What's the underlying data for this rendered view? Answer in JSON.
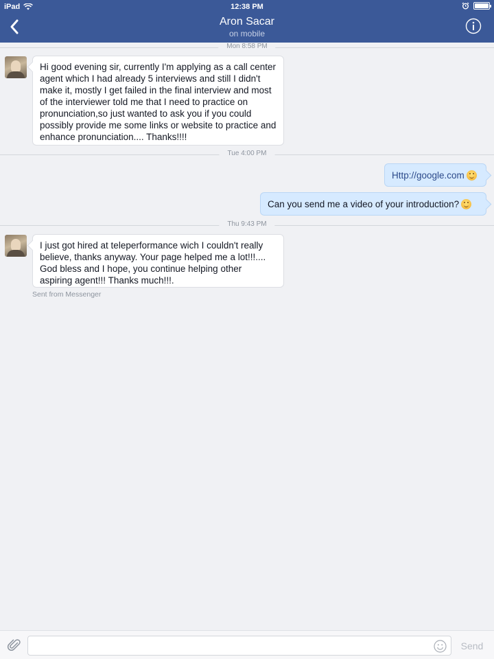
{
  "status_bar": {
    "device": "iPad",
    "time": "12:38 PM",
    "battery_level": 1.0
  },
  "header": {
    "title": "Aron Sacar",
    "subtitle": "on mobile",
    "back_icon": "chevron-left-icon",
    "info_icon": "info-icon"
  },
  "thread": {
    "dividers": [
      "Mon 8:58 PM",
      "Tue 4:00 PM",
      "Thu 9:43 PM"
    ],
    "messages": [
      {
        "direction": "in",
        "text": "Hi good evening sir, currently I'm applying as a call center agent which I had already 5 interviews and still I didn't make it, mostly I get failed in the final interview and most of the interviewer told me that I need to practice on pronunciation,so just wanted to ask you if you could possibly provide me some links or website to practice and enhance pronunciation.... Thanks!!!!"
      },
      {
        "direction": "out",
        "text": "Http://google.com",
        "emoji": "smile-emoji"
      },
      {
        "direction": "out",
        "text": "Can you send me a video of your introduction?",
        "emoji": "smile-emoji"
      },
      {
        "direction": "in",
        "text": "I just got hired at teleperformance wich I couldn't really believe, thanks anyway. Your page helped me a lot!!!.... God bless and I hope, you continue helping other aspiring agent!!! Thanks much!!!."
      }
    ],
    "sent_from": "Sent from Messenger"
  },
  "composer": {
    "input_value": "",
    "placeholder": "",
    "send_label": "Send",
    "attach_icon": "paperclip-icon",
    "emoji_icon": "emoji-icon"
  },
  "colors": {
    "header_bg": "#3b5998",
    "outgoing_bubble": "#d6eaff",
    "incoming_bubble": "#ffffff",
    "background": "#f0f1f4"
  }
}
